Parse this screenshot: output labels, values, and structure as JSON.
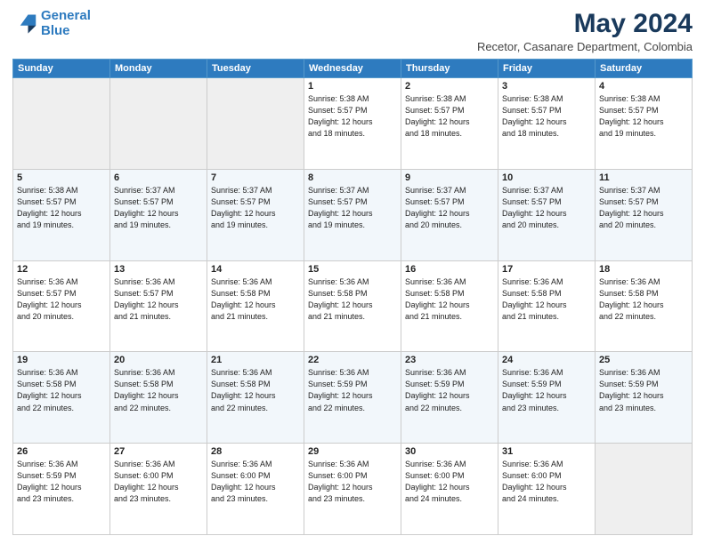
{
  "header": {
    "logo_line1": "General",
    "logo_line2": "Blue",
    "title": "May 2024",
    "subtitle": "Recetor, Casanare Department, Colombia"
  },
  "calendar": {
    "days_of_week": [
      "Sunday",
      "Monday",
      "Tuesday",
      "Wednesday",
      "Thursday",
      "Friday",
      "Saturday"
    ],
    "weeks": [
      [
        {
          "day": "",
          "info": ""
        },
        {
          "day": "",
          "info": ""
        },
        {
          "day": "",
          "info": ""
        },
        {
          "day": "1",
          "info": "Sunrise: 5:38 AM\nSunset: 5:57 PM\nDaylight: 12 hours\nand 18 minutes."
        },
        {
          "day": "2",
          "info": "Sunrise: 5:38 AM\nSunset: 5:57 PM\nDaylight: 12 hours\nand 18 minutes."
        },
        {
          "day": "3",
          "info": "Sunrise: 5:38 AM\nSunset: 5:57 PM\nDaylight: 12 hours\nand 18 minutes."
        },
        {
          "day": "4",
          "info": "Sunrise: 5:38 AM\nSunset: 5:57 PM\nDaylight: 12 hours\nand 19 minutes."
        }
      ],
      [
        {
          "day": "5",
          "info": "Sunrise: 5:38 AM\nSunset: 5:57 PM\nDaylight: 12 hours\nand 19 minutes."
        },
        {
          "day": "6",
          "info": "Sunrise: 5:37 AM\nSunset: 5:57 PM\nDaylight: 12 hours\nand 19 minutes."
        },
        {
          "day": "7",
          "info": "Sunrise: 5:37 AM\nSunset: 5:57 PM\nDaylight: 12 hours\nand 19 minutes."
        },
        {
          "day": "8",
          "info": "Sunrise: 5:37 AM\nSunset: 5:57 PM\nDaylight: 12 hours\nand 19 minutes."
        },
        {
          "day": "9",
          "info": "Sunrise: 5:37 AM\nSunset: 5:57 PM\nDaylight: 12 hours\nand 20 minutes."
        },
        {
          "day": "10",
          "info": "Sunrise: 5:37 AM\nSunset: 5:57 PM\nDaylight: 12 hours\nand 20 minutes."
        },
        {
          "day": "11",
          "info": "Sunrise: 5:37 AM\nSunset: 5:57 PM\nDaylight: 12 hours\nand 20 minutes."
        }
      ],
      [
        {
          "day": "12",
          "info": "Sunrise: 5:36 AM\nSunset: 5:57 PM\nDaylight: 12 hours\nand 20 minutes."
        },
        {
          "day": "13",
          "info": "Sunrise: 5:36 AM\nSunset: 5:57 PM\nDaylight: 12 hours\nand 21 minutes."
        },
        {
          "day": "14",
          "info": "Sunrise: 5:36 AM\nSunset: 5:58 PM\nDaylight: 12 hours\nand 21 minutes."
        },
        {
          "day": "15",
          "info": "Sunrise: 5:36 AM\nSunset: 5:58 PM\nDaylight: 12 hours\nand 21 minutes."
        },
        {
          "day": "16",
          "info": "Sunrise: 5:36 AM\nSunset: 5:58 PM\nDaylight: 12 hours\nand 21 minutes."
        },
        {
          "day": "17",
          "info": "Sunrise: 5:36 AM\nSunset: 5:58 PM\nDaylight: 12 hours\nand 21 minutes."
        },
        {
          "day": "18",
          "info": "Sunrise: 5:36 AM\nSunset: 5:58 PM\nDaylight: 12 hours\nand 22 minutes."
        }
      ],
      [
        {
          "day": "19",
          "info": "Sunrise: 5:36 AM\nSunset: 5:58 PM\nDaylight: 12 hours\nand 22 minutes."
        },
        {
          "day": "20",
          "info": "Sunrise: 5:36 AM\nSunset: 5:58 PM\nDaylight: 12 hours\nand 22 minutes."
        },
        {
          "day": "21",
          "info": "Sunrise: 5:36 AM\nSunset: 5:58 PM\nDaylight: 12 hours\nand 22 minutes."
        },
        {
          "day": "22",
          "info": "Sunrise: 5:36 AM\nSunset: 5:59 PM\nDaylight: 12 hours\nand 22 minutes."
        },
        {
          "day": "23",
          "info": "Sunrise: 5:36 AM\nSunset: 5:59 PM\nDaylight: 12 hours\nand 22 minutes."
        },
        {
          "day": "24",
          "info": "Sunrise: 5:36 AM\nSunset: 5:59 PM\nDaylight: 12 hours\nand 23 minutes."
        },
        {
          "day": "25",
          "info": "Sunrise: 5:36 AM\nSunset: 5:59 PM\nDaylight: 12 hours\nand 23 minutes."
        }
      ],
      [
        {
          "day": "26",
          "info": "Sunrise: 5:36 AM\nSunset: 5:59 PM\nDaylight: 12 hours\nand 23 minutes."
        },
        {
          "day": "27",
          "info": "Sunrise: 5:36 AM\nSunset: 6:00 PM\nDaylight: 12 hours\nand 23 minutes."
        },
        {
          "day": "28",
          "info": "Sunrise: 5:36 AM\nSunset: 6:00 PM\nDaylight: 12 hours\nand 23 minutes."
        },
        {
          "day": "29",
          "info": "Sunrise: 5:36 AM\nSunset: 6:00 PM\nDaylight: 12 hours\nand 23 minutes."
        },
        {
          "day": "30",
          "info": "Sunrise: 5:36 AM\nSunset: 6:00 PM\nDaylight: 12 hours\nand 24 minutes."
        },
        {
          "day": "31",
          "info": "Sunrise: 5:36 AM\nSunset: 6:00 PM\nDaylight: 12 hours\nand 24 minutes."
        },
        {
          "day": "",
          "info": ""
        }
      ]
    ]
  }
}
